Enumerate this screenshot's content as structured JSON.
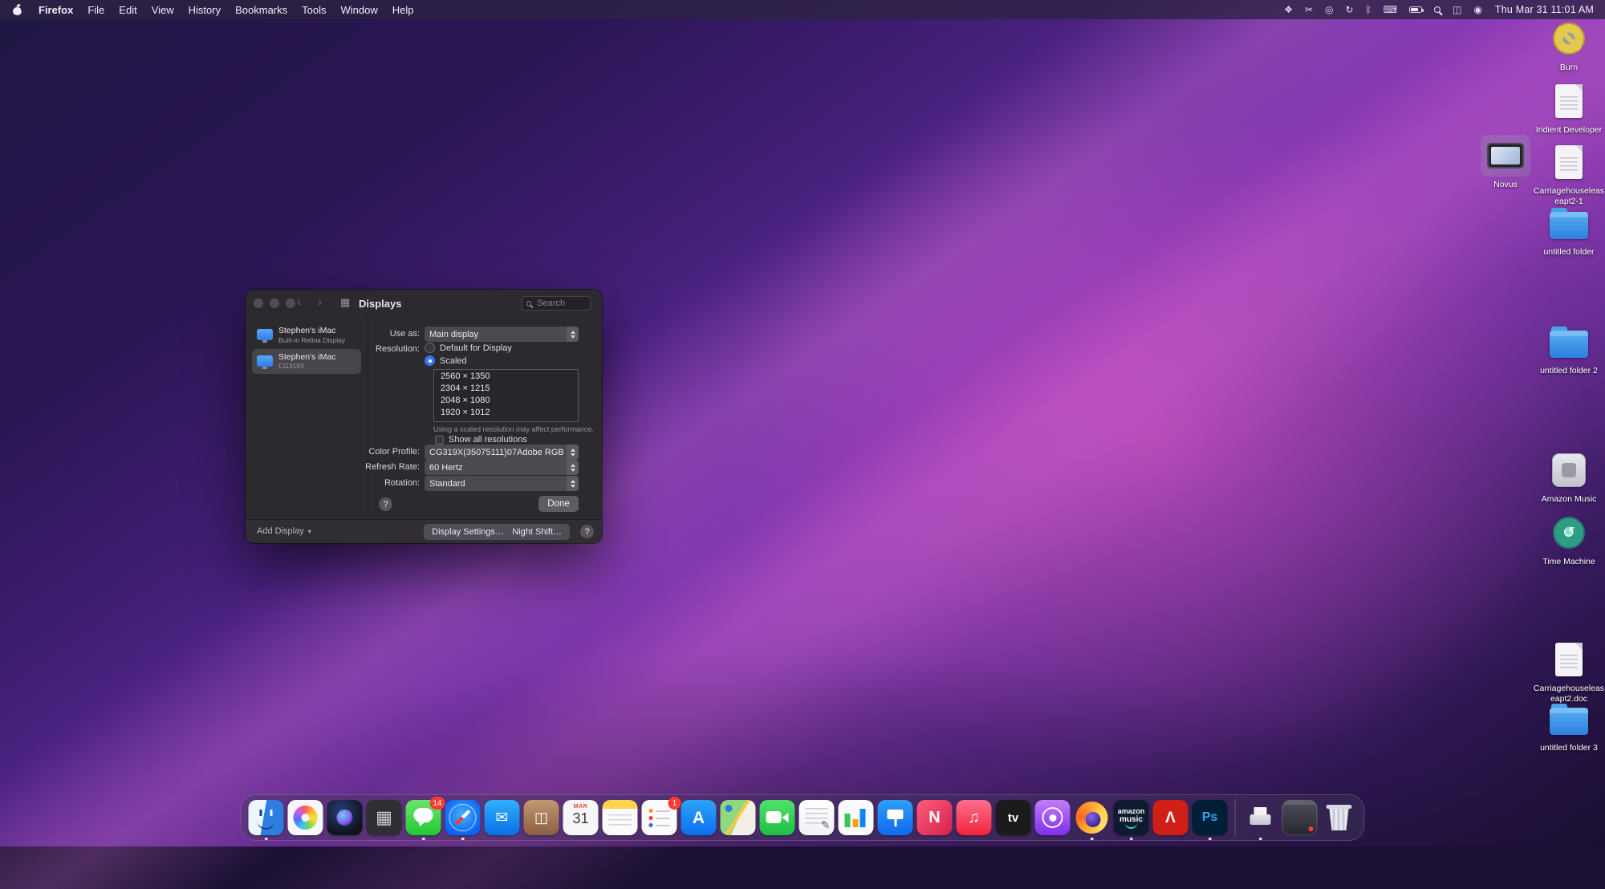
{
  "colors": {
    "accent": "#3577f6",
    "badge": "#ff3b30",
    "window_bg": "#2c2a2e"
  },
  "menubar": {
    "app_name": "Firefox",
    "menus": [
      "File",
      "Edit",
      "View",
      "History",
      "Bookmarks",
      "Tools",
      "Window",
      "Help"
    ],
    "status_icons": [
      {
        "name": "dropbox-icon",
        "glyph": "❖"
      },
      {
        "name": "scissors-icon",
        "glyph": "✂"
      },
      {
        "name": "creative-cloud-icon",
        "glyph": "◎"
      },
      {
        "name": "sync-icon",
        "glyph": "↻"
      },
      {
        "name": "bluetooth-icon",
        "glyph": "ᛒ"
      },
      {
        "name": "keyboard-icon",
        "glyph": "⌨"
      },
      {
        "name": "battery-icon",
        "css": "batt"
      },
      {
        "name": "spotlight-icon",
        "css": "mag"
      },
      {
        "name": "control-center-icon",
        "glyph": "◫"
      },
      {
        "name": "siri-icon",
        "glyph": "◉"
      }
    ],
    "clock": "Thu Mar 31 11:01 AM"
  },
  "desktop_icons": [
    {
      "label": "Burn",
      "type": "burn"
    },
    {
      "label": "Iridient Developer",
      "type": "doc"
    },
    {
      "label": "Novus",
      "type": "novus",
      "selected": true
    },
    {
      "label": "Carriagehouseleaseapt2-1",
      "type": "doc"
    },
    {
      "label": "untitled folder",
      "type": "folder"
    },
    {
      "label": "untitled folder 2",
      "type": "folder"
    },
    {
      "label": "Amazon Music",
      "type": "app-gray"
    },
    {
      "label": "Time Machine",
      "type": "timemachine"
    },
    {
      "label": "Carriagehouseleaseapt2.doc",
      "type": "doc"
    },
    {
      "label": "untitled folder 3",
      "type": "folder"
    }
  ],
  "window": {
    "title": "Displays",
    "search_placeholder": "Search",
    "sidebar": [
      {
        "title": "Stephen's iMac",
        "subtitle": "Built-in Retina Display"
      },
      {
        "title": "Stephen's iMac",
        "subtitle": "CG319X"
      }
    ],
    "use_as_label": "Use as:",
    "use_as_value": "Main display",
    "resolution_label": "Resolution:",
    "radio_default_label": "Default for Display",
    "radio_scaled_label": "Scaled",
    "resolutions": [
      "2560 × 1350",
      "2304 × 1215",
      "2048 × 1080",
      "1920 × 1012"
    ],
    "note": "Using a scaled resolution may affect performance.",
    "show_all_label": "Show all resolutions",
    "color_profile_label": "Color Profile:",
    "color_profile_value": "CG319X(35075111)07Adobe RGB",
    "refresh_rate_label": "Refresh Rate:",
    "refresh_rate_value": "60 Hertz",
    "rotation_label": "Rotation:",
    "rotation_value": "Standard",
    "help_label": "?",
    "done_label": "Done",
    "add_display_label": "Add Display",
    "display_settings_label": "Display Settings…",
    "night_shift_label": "Night Shift…"
  },
  "dock": {
    "items": [
      {
        "name": "finder",
        "shape": "finder",
        "running": true
      },
      {
        "name": "photos",
        "shape": "photos"
      },
      {
        "name": "siri",
        "shape": "siri"
      },
      {
        "name": "launchpad",
        "bg": "#2e2e33",
        "glyph": "▦",
        "fg": "#cfcfd6",
        "gsize": 22
      },
      {
        "name": "messages",
        "shape": "bubble",
        "bg": "linear-gradient(180deg,#6de36f,#20c933)",
        "badge": "14",
        "running": true
      },
      {
        "name": "safari",
        "shape": "safari",
        "running": true
      },
      {
        "name": "mail",
        "bg": "linear-gradient(180deg,#2fb0fa,#0a6fe8)",
        "glyph": "✉",
        "fg": "#ffffff",
        "gsize": 19
      },
      {
        "name": "photo-booth",
        "bg": "linear-gradient(180deg,#c09a72,#8a5f42)",
        "glyph": "◫",
        "fg": "#ffffff",
        "gsize": 18
      },
      {
        "name": "calendar",
        "shape": "calendar",
        "month": "MAR",
        "day": "31"
      },
      {
        "name": "notes",
        "shape": "notes"
      },
      {
        "name": "reminders",
        "shape": "reminders",
        "badge": "1"
      },
      {
        "name": "app-store",
        "bg": "linear-gradient(180deg,#2ba4f6,#0d6ef0)",
        "glyph": "A",
        "fg": "#ffffff",
        "gsize": 21,
        "gweight": 700
      },
      {
        "name": "maps",
        "shape": "maps"
      },
      {
        "name": "facetime",
        "shape": "facetime",
        "bg": "linear-gradient(180deg,#51e16c,#1fbf44)"
      },
      {
        "name": "textedit",
        "shape": "textedit"
      },
      {
        "name": "numbers",
        "shape": "numbers"
      },
      {
        "name": "keynote",
        "shape": "keynote",
        "bg": "linear-gradient(180deg,#2f9ff7,#0d6aed)"
      },
      {
        "name": "news",
        "bg": "linear-gradient(135deg,#ff5e7a,#d61f4e)",
        "glyph": "N",
        "fg": "#ffffff",
        "gsize": 20,
        "gweight": 700
      },
      {
        "name": "music",
        "bg": "linear-gradient(180deg,#fd6e8b,#f5233c)",
        "glyph": "♫",
        "fg": "#ffffff",
        "gsize": 20
      },
      {
        "name": "apple-tv",
        "bg": "#1b1b1d",
        "glyph": "tv",
        "fg": "#ffffff",
        "gsize": 15,
        "gweight": 700
      },
      {
        "name": "podcasts",
        "shape": "podcasts",
        "bg": "linear-gradient(180deg,#c17df8,#7f2df0)"
      },
      {
        "name": "firefox",
        "shape": "firefox",
        "running": true
      },
      {
        "name": "amazon-music",
        "shape": "amazon-music",
        "line1": "amazon",
        "line2": "music",
        "running": true
      },
      {
        "name": "acrobat",
        "bg": "#cf1f17",
        "glyph": "Λ",
        "fg": "#ffffff",
        "gsize": 19,
        "gweight": 700
      },
      {
        "name": "photoshop",
        "bg": "#001e36",
        "glyph": "Ps",
        "fg": "#31a8ff",
        "gsize": 16,
        "gweight": 700,
        "running": true
      },
      {
        "separator": true
      },
      {
        "name": "printer",
        "shape": "printer",
        "running": true
      },
      {
        "name": "minimized-window",
        "shape": "minwin"
      },
      {
        "name": "trash",
        "shape": "trash"
      }
    ]
  }
}
